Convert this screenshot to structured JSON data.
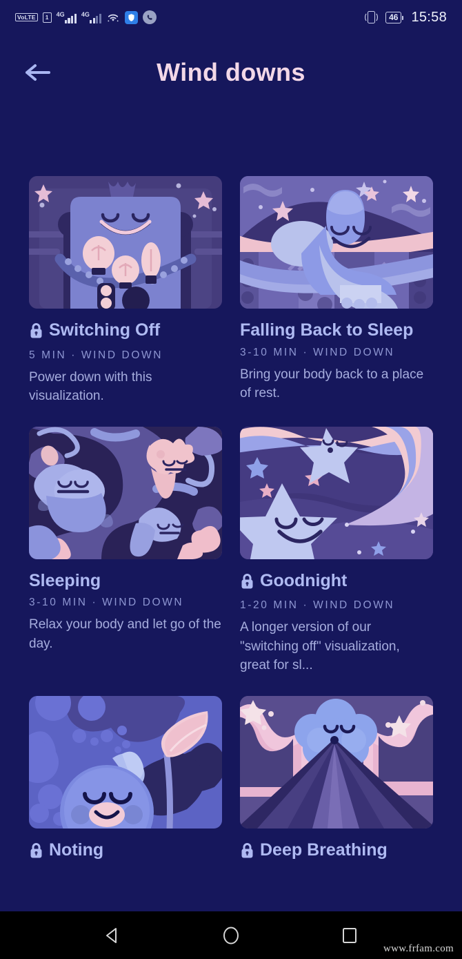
{
  "status_bar": {
    "volte_label": "VoLTE",
    "sim_label": "1",
    "network_label_1": "4G",
    "network_label_2": "4G",
    "wifi_icon": "wifi-icon",
    "shield_icon": "shield-icon",
    "phone_icon": "phone-icon",
    "vibrate_icon": "vibrate-icon",
    "battery_level": "46",
    "time": "15:58"
  },
  "header": {
    "back_icon": "back-arrow-icon",
    "title": "Wind downs"
  },
  "colors": {
    "background": "#16175C",
    "title": "#F3D8E8",
    "card_title": "#AFBAF2",
    "card_meta": "#8E96D2",
    "card_desc": "#A6ADDE",
    "accent_pink": "#F0B8CE",
    "accent_blue": "#8C9BE8"
  },
  "cards": [
    {
      "title": "Switching Off",
      "locked": true,
      "lock_icon": "lock-icon",
      "meta": "5 MIN · WIND DOWN",
      "description": "Power down with this visualization.",
      "thumbnail": "character-with-lightbulbs-illustration"
    },
    {
      "title": "Falling Back to Sleep",
      "locked": false,
      "lock_icon": "",
      "meta": "3-10 MIN · WIND DOWN",
      "description": "Bring your body back to a place of rest.",
      "thumbnail": "creature-sleeping-in-quilt-bed-illustration"
    },
    {
      "title": "Sleeping",
      "locked": false,
      "lock_icon": "",
      "meta": "3-10 MIN · WIND DOWN",
      "description": "Relax your body and let go of the day.",
      "thumbnail": "sleepy-blob-creatures-illustration"
    },
    {
      "title": "Goodnight",
      "locked": true,
      "lock_icon": "lock-icon",
      "meta": "1-20 MIN · WIND DOWN",
      "description": "A longer version of our \"switching off\" visualization, great for sl...",
      "thumbnail": "smiling-stars-with-ribbons-illustration"
    },
    {
      "title": "Noting",
      "locked": true,
      "lock_icon": "lock-icon",
      "meta": "",
      "description": "",
      "thumbnail": "creature-with-feather-illustration"
    },
    {
      "title": "Deep Breathing",
      "locked": true,
      "lock_icon": "lock-icon",
      "meta": "",
      "description": "",
      "thumbnail": "mountain-road-cloud-face-illustration"
    }
  ],
  "nav_bar": {
    "back_icon": "triangle-back-icon",
    "home_icon": "circle-home-icon",
    "recents_icon": "square-recents-icon",
    "watermark": "www.frfam.com"
  }
}
